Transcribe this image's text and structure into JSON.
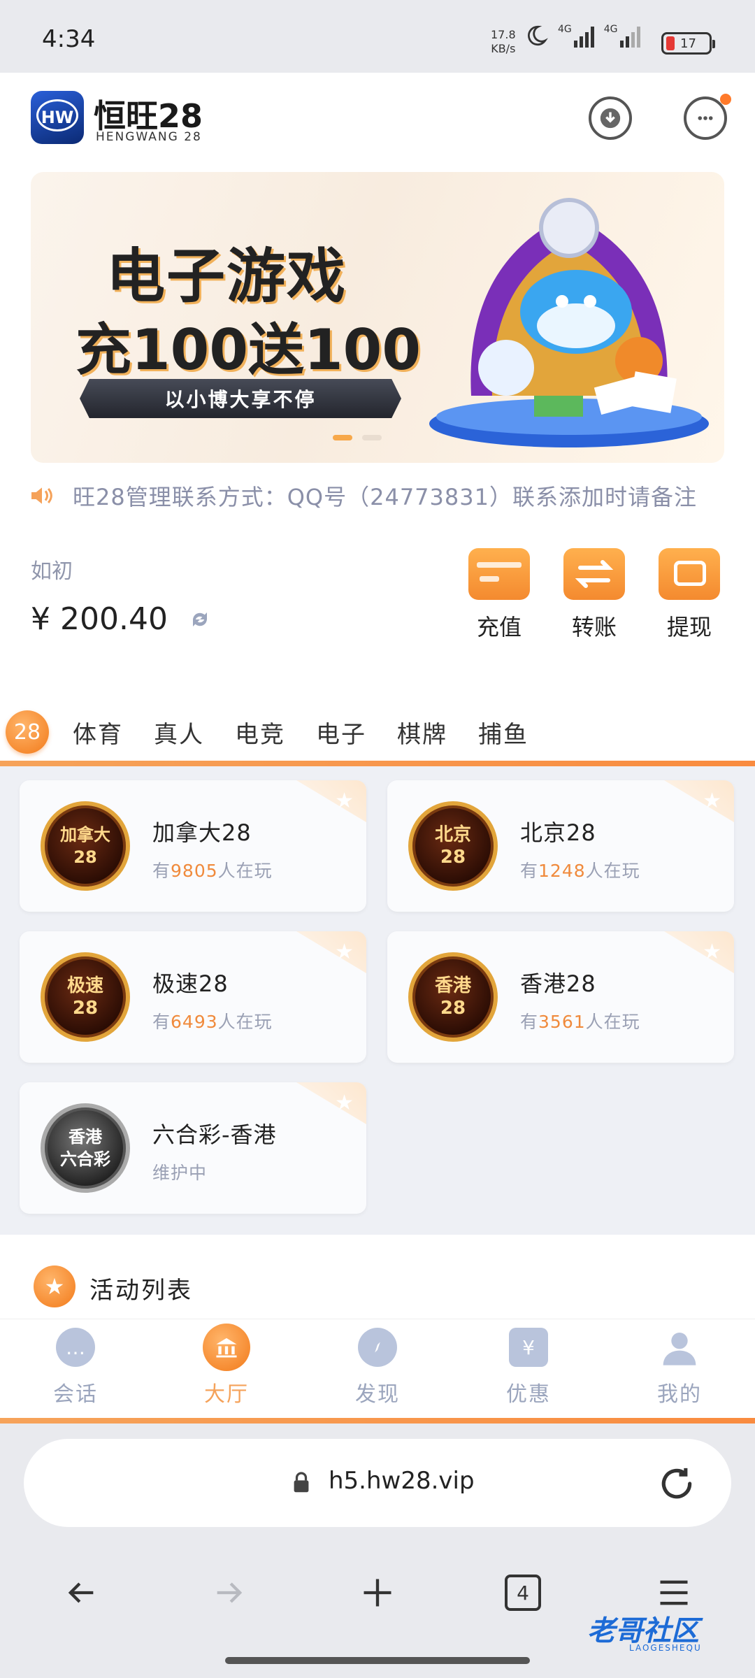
{
  "status_bar": {
    "time": "4:34",
    "net_speed": "17.8",
    "net_speed_unit": "KB/s",
    "network_1": "4G",
    "network_2": "4G",
    "battery": "17"
  },
  "header": {
    "logo_badge": "HW",
    "logo_title": "恒旺28",
    "logo_subtitle": "HENGWANG 28"
  },
  "banner": {
    "line1": "电子游戏",
    "line2": "充100送100",
    "ribbon": "以小博大享不停"
  },
  "notice": {
    "text": "旺28管理联系方式：QQ号（24773831）联系添加时请备注"
  },
  "account": {
    "name": "如初",
    "balance": "¥ 200.40"
  },
  "quick_actions": [
    {
      "label": "充值"
    },
    {
      "label": "转账"
    },
    {
      "label": "提现"
    }
  ],
  "tabs": [
    "28",
    "体育",
    "真人",
    "电竞",
    "电子",
    "棋牌",
    "捕鱼"
  ],
  "games": [
    {
      "name": "加拿大28",
      "coin": "加拿大\n28",
      "prefix": "有",
      "count": "9805",
      "suffix": "人在玩"
    },
    {
      "name": "北京28",
      "coin": "北京\n28",
      "prefix": "有",
      "count": "1248",
      "suffix": "人在玩"
    },
    {
      "name": "极速28",
      "coin": "极速\n28",
      "prefix": "有",
      "count": "6493",
      "suffix": "人在玩"
    },
    {
      "name": "香港28",
      "coin": "香港\n28",
      "prefix": "有",
      "count": "3561",
      "suffix": "人在玩"
    },
    {
      "name": "六合彩-香港",
      "coin": "香港\n六合彩",
      "status": "维护中"
    }
  ],
  "activity": {
    "title": "活动列表"
  },
  "bottom_nav": [
    {
      "label": "会话"
    },
    {
      "label": "大厅"
    },
    {
      "label": "发现"
    },
    {
      "label": "优惠"
    },
    {
      "label": "我的"
    }
  ],
  "browser": {
    "url": "h5.hw28.vip",
    "tab_count": "4"
  },
  "watermark": {
    "text": "老哥社区",
    "sub": "LAOGESHEQU"
  },
  "colors": {
    "accent": "#f5a25a",
    "accent_dark": "#f27a1a",
    "nav_inactive": "#9ba5bd"
  }
}
